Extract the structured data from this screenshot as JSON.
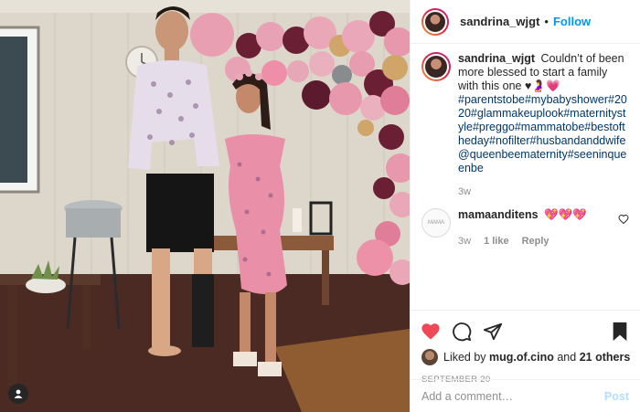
{
  "post": {
    "username": "sandrina_wjgt",
    "follow_label": "Follow",
    "separator": "•",
    "caption": {
      "username": "sandrina_wjgt",
      "text": "Couldn’t of been more blessed to start a family with this one ♥🤰💗",
      "tags": "#parentstobe#mybabyshower#2020#glammakeuplook#maternitystyle#preggo#mammatobe#bestoftheday#nofilter#husbandanddwife@queenbeematernity#seeninqueenbe",
      "age": "3w"
    },
    "comments": [
      {
        "username": "mamaanditens",
        "text": "💖💖💖",
        "age": "3w",
        "likes": "1 like",
        "reply_label": "Reply",
        "avatar_text": "MAMA"
      }
    ],
    "likes": {
      "prefix": "Liked by",
      "user": "mug.of.cino",
      "and": "and",
      "others": "21 others"
    },
    "date": "SEPTEMBER 20",
    "add_comment_placeholder": "Add a comment…",
    "post_label": "Post"
  },
  "icons": {
    "like": "heart-icon",
    "comment": "comment-icon",
    "share": "share-icon",
    "save": "bookmark-icon",
    "tagged": "user-tag-icon"
  },
  "colors": {
    "accent": "#0095f6",
    "heart": "#ed4956",
    "text": "#262626",
    "muted": "#8e8e8e"
  }
}
